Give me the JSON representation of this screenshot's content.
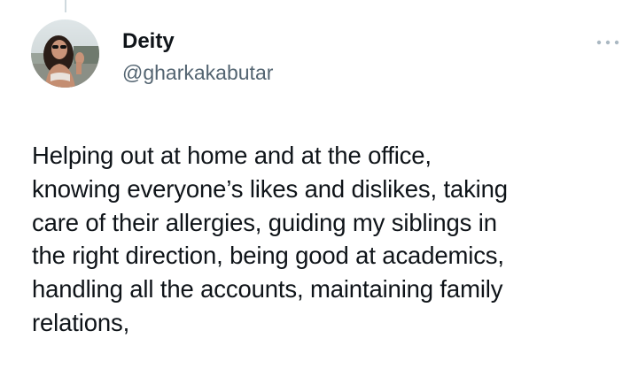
{
  "tweet": {
    "author": {
      "display_name": "Deity",
      "handle": "@gharkakabutar",
      "avatar_icon": "profile-photo"
    },
    "more_icon": "more-options-icon",
    "text": "Helping out at home and at the office,\nknowing everyone’s likes and dislikes, taking\ncare of their allergies, guiding my siblings in\nthe right direction, being good at academics,\nhandling all the accounts, maintaining family\nrelations,"
  },
  "colors": {
    "text_primary": "#0f1419",
    "text_secondary": "#536471",
    "divider": "#cfd9de"
  }
}
